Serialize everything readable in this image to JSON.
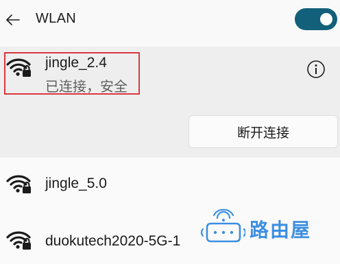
{
  "header": {
    "title": "WLAN",
    "toggle_on": true,
    "accent_color": "#12607a"
  },
  "connected_network": {
    "name": "jingle_2.4",
    "status": "已连接，安全",
    "disconnect_label": "断开连接",
    "icon": "wifi-secured-icon",
    "info_icon": "info-icon"
  },
  "networks": [
    {
      "name": "jingle_5.0",
      "icon": "wifi-secured-icon"
    },
    {
      "name": "duokutech2020-5G-1",
      "icon": "wifi-secured-icon"
    }
  ],
  "watermark": {
    "text": "路由屋",
    "color": "#3d8fe0"
  }
}
